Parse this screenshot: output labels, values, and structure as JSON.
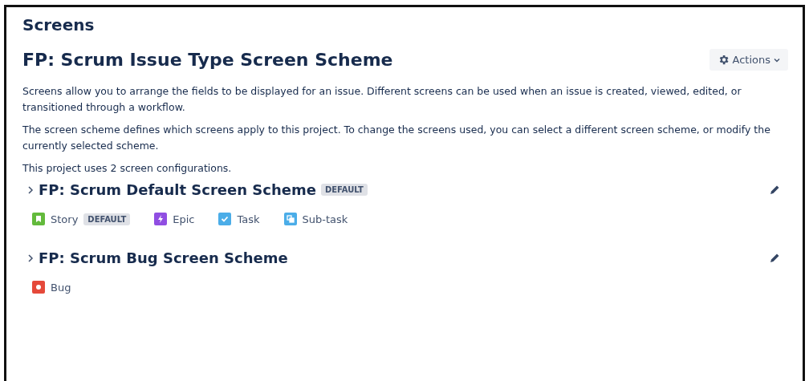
{
  "page_title": "Screens",
  "scheme_title": "FP: Scrum Issue Type Screen Scheme",
  "actions_button": {
    "label": "Actions"
  },
  "paragraphs": [
    "Screens allow you to arrange the fields to be displayed for an issue. Different screens can be used when an issue is created, viewed, edited, or transitioned through a workflow.",
    "The screen scheme defines which screens apply to this project. To change the screens used, you can select a different screen scheme, or modify the currently selected scheme.",
    "This project uses 2 screen configurations."
  ],
  "schemes": [
    {
      "name": "FP: Scrum Default Screen Scheme",
      "expanded": false,
      "badge": "DEFAULT",
      "issue_types": [
        {
          "name": "Story",
          "kind": "story",
          "color": "#63ba3c",
          "badge": "DEFAULT"
        },
        {
          "name": "Epic",
          "kind": "epic",
          "color": "#904ee2"
        },
        {
          "name": "Task",
          "kind": "task",
          "color": "#4bade8"
        },
        {
          "name": "Sub-task",
          "kind": "subtask",
          "color": "#4bade8"
        }
      ]
    },
    {
      "name": "FP: Scrum Bug Screen Scheme",
      "expanded": false,
      "issue_types": [
        {
          "name": "Bug",
          "kind": "bug",
          "color": "#e5493a"
        }
      ]
    }
  ]
}
